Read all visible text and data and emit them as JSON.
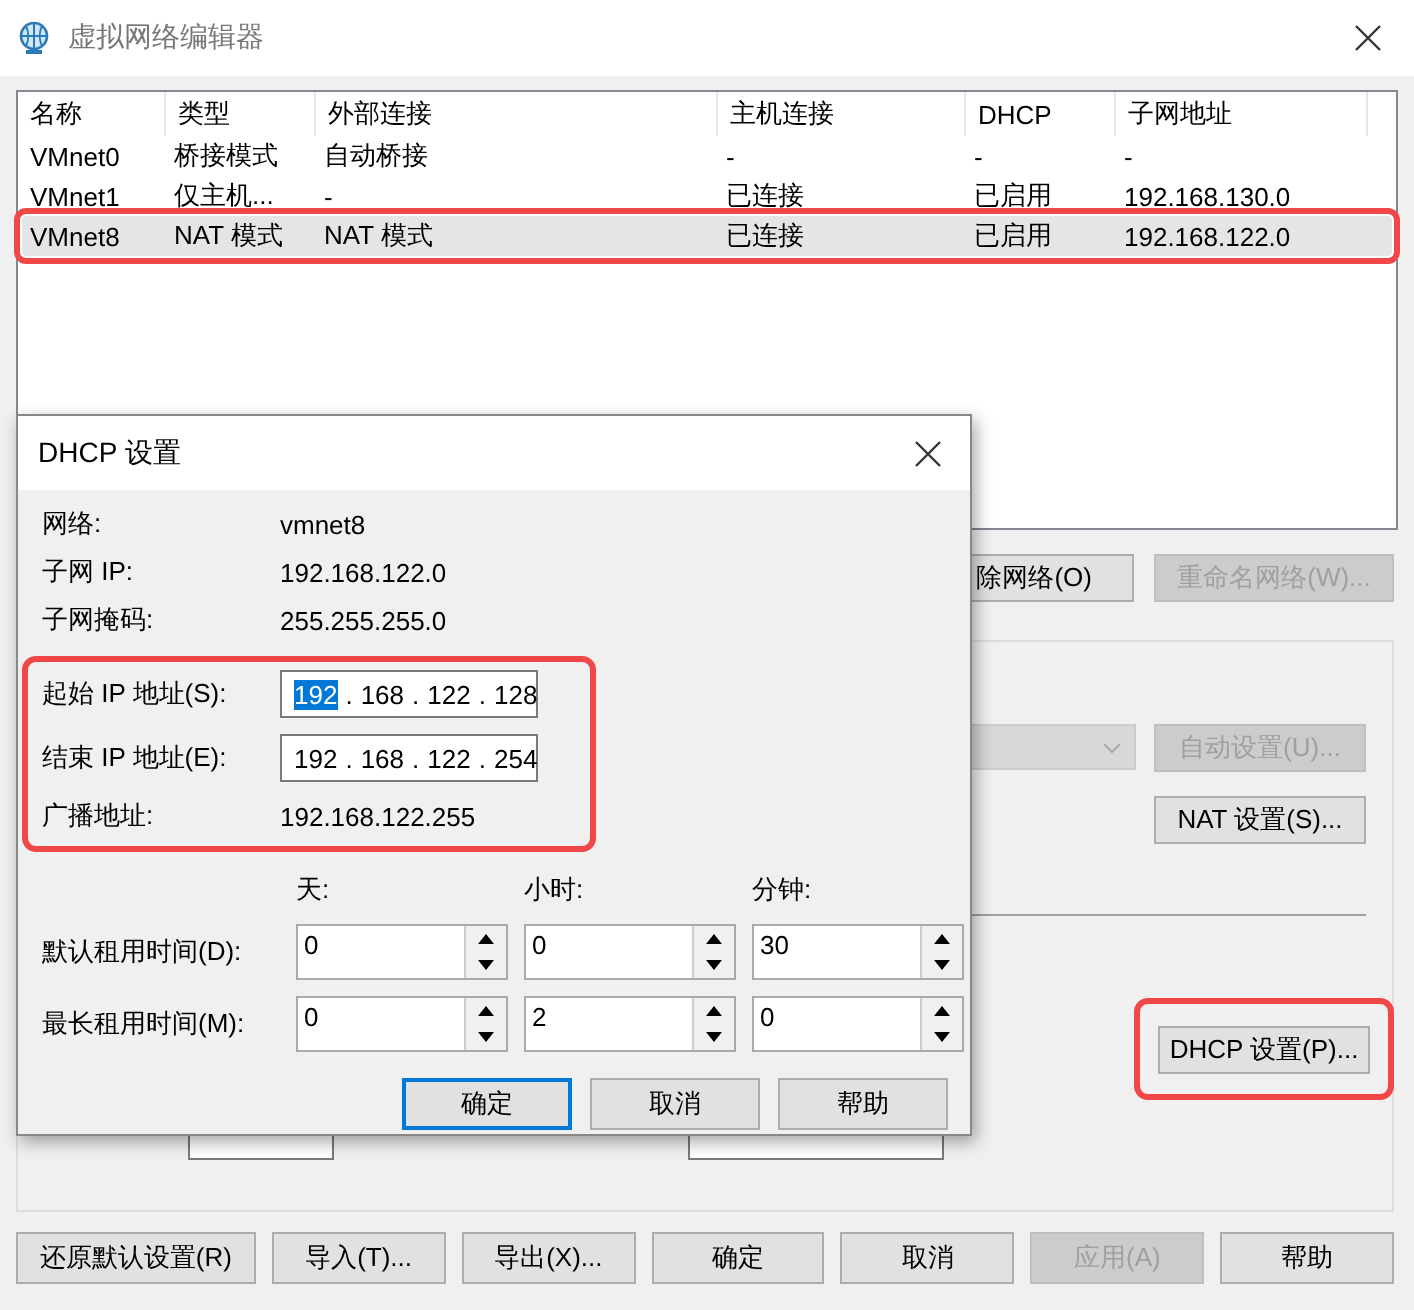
{
  "window": {
    "title": "虚拟网络编辑器"
  },
  "networks": {
    "columns": [
      "名称",
      "类型",
      "外部连接",
      "主机连接",
      "DHCP",
      "子网地址"
    ],
    "rows": [
      {
        "cells": [
          "VMnet0",
          "桥接模式",
          "自动桥接",
          "-",
          "-",
          "-"
        ],
        "selected": false,
        "highlighted": false
      },
      {
        "cells": [
          "VMnet1",
          "仅主机...",
          "-",
          "已连接",
          "已启用",
          "192.168.130.0"
        ],
        "selected": false,
        "highlighted": false
      },
      {
        "cells": [
          "VMnet8",
          "NAT 模式",
          "NAT 模式",
          "已连接",
          "已启用",
          "192.168.122.0"
        ],
        "selected": true,
        "highlighted": true
      }
    ]
  },
  "network_buttons": [
    {
      "label": "除网络(O)",
      "disabled": false
    },
    {
      "label": "重命名网络(W)...",
      "disabled": true
    }
  ],
  "settings": {
    "dropdown": {
      "disabled": true
    },
    "auto_button": {
      "label": "自动设置(U)...",
      "disabled": true
    },
    "nat_button": {
      "label": "NAT 设置(S)...",
      "disabled": false
    },
    "dhcp_button": {
      "label": "DHCP 设置(P)...",
      "disabled": false,
      "highlighted": true
    }
  },
  "footer_buttons": [
    {
      "label": "还原默认设置(R)",
      "disabled": false
    },
    {
      "label": "导入(T)...",
      "disabled": false
    },
    {
      "label": "导出(X)...",
      "disabled": false
    },
    {
      "label": "确定",
      "disabled": false
    },
    {
      "label": "取消",
      "disabled": false
    },
    {
      "label": "应用(A)",
      "disabled": true
    },
    {
      "label": "帮助",
      "disabled": false
    }
  ],
  "dhcp_dialog": {
    "title": "DHCP 设置",
    "info": [
      {
        "label": "网络:",
        "value": "vmnet8"
      },
      {
        "label": "子网 IP:",
        "value": "192.168.122.0"
      },
      {
        "label": "子网掩码:",
        "value": "255.255.255.0"
      }
    ],
    "range_highlighted": true,
    "range": [
      {
        "kind": "field",
        "label": "起始 IP 地址(S):",
        "separator": ".",
        "octets": [
          {
            "text": "192",
            "selected": true
          },
          {
            "text": "168",
            "selected": false
          },
          {
            "text": "122",
            "selected": false
          },
          {
            "text": "128",
            "selected": false
          }
        ]
      },
      {
        "kind": "field",
        "label": "结束 IP 地址(E):",
        "separator": ".",
        "octets": [
          {
            "text": "192",
            "selected": false
          },
          {
            "text": "168",
            "selected": false
          },
          {
            "text": "122",
            "selected": false
          },
          {
            "text": "254",
            "selected": false
          }
        ]
      },
      {
        "kind": "text",
        "label": "广播地址:",
        "value": "192.168.122.255"
      }
    ],
    "lease_columns": [
      "天:",
      "小时:",
      "分钟:"
    ],
    "lease_rows": [
      {
        "label": "默认租用时间(D):",
        "values": [
          "0",
          "0",
          "30"
        ]
      },
      {
        "label": "最长租用时间(M):",
        "values": [
          "0",
          "2",
          "0"
        ]
      }
    ],
    "buttons": [
      {
        "label": "确定",
        "default": true
      },
      {
        "label": "取消",
        "default": false
      },
      {
        "label": "帮助",
        "default": false
      }
    ]
  }
}
